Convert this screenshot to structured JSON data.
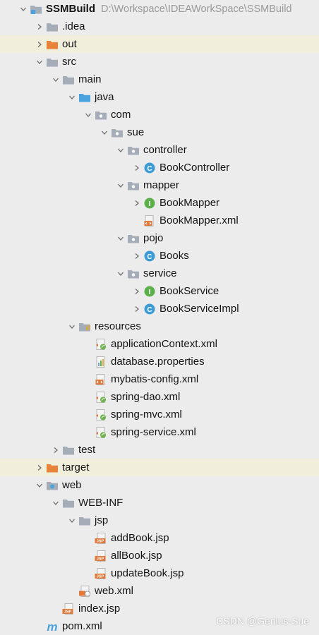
{
  "colors": {
    "folder": "#a5adb8",
    "folder_blue": "#4aa3df",
    "folder_orange": "#e8833a",
    "class_badge": "#3c9bd4",
    "interface_badge": "#5bb04a",
    "xml": "#e0783a",
    "spring_leaf": "#6bb24a",
    "jsp": "#e0783a",
    "highlight": "#f1efdc"
  },
  "tree": [
    {
      "label": "SSMBuild",
      "path": "D:\\Workspace\\IDEAWorkSpace\\SSMBuild",
      "icon": "module-folder-icon",
      "expanded": true,
      "depth": 0
    },
    {
      "label": ".idea",
      "icon": "folder-icon",
      "expanded": false,
      "depth": 1
    },
    {
      "label": "out",
      "icon": "excluded-folder-icon",
      "expanded": false,
      "depth": 1,
      "highlight": true
    },
    {
      "label": "src",
      "icon": "folder-icon",
      "expanded": true,
      "depth": 1
    },
    {
      "label": "main",
      "icon": "folder-icon",
      "expanded": true,
      "depth": 2
    },
    {
      "label": "java",
      "icon": "source-folder-icon",
      "expanded": true,
      "depth": 3
    },
    {
      "label": "com",
      "icon": "package-icon",
      "expanded": true,
      "depth": 4
    },
    {
      "label": "sue",
      "icon": "package-icon",
      "expanded": true,
      "depth": 5
    },
    {
      "label": "controller",
      "icon": "package-icon",
      "expanded": true,
      "depth": 6
    },
    {
      "label": "BookController",
      "icon": "class-icon",
      "expanded": false,
      "depth": 7
    },
    {
      "label": "mapper",
      "icon": "package-icon",
      "expanded": true,
      "depth": 6
    },
    {
      "label": "BookMapper",
      "icon": "interface-icon",
      "expanded": false,
      "depth": 7
    },
    {
      "label": "BookMapper.xml",
      "icon": "xml-file-icon",
      "depth": 7
    },
    {
      "label": "pojo",
      "icon": "package-icon",
      "expanded": true,
      "depth": 6
    },
    {
      "label": "Books",
      "icon": "class-icon",
      "expanded": false,
      "depth": 7
    },
    {
      "label": "service",
      "icon": "package-icon",
      "expanded": true,
      "depth": 6
    },
    {
      "label": "BookService",
      "icon": "interface-icon",
      "expanded": false,
      "depth": 7
    },
    {
      "label": "BookServiceImpl",
      "icon": "class-icon",
      "expanded": false,
      "depth": 7
    },
    {
      "label": "resources",
      "icon": "resources-folder-icon",
      "expanded": true,
      "depth": 3
    },
    {
      "label": "applicationContext.xml",
      "icon": "spring-xml-icon",
      "depth": 4
    },
    {
      "label": "database.properties",
      "icon": "properties-file-icon",
      "depth": 4
    },
    {
      "label": "mybatis-config.xml",
      "icon": "xml-file-icon",
      "depth": 4
    },
    {
      "label": "spring-dao.xml",
      "icon": "spring-xml-icon",
      "depth": 4
    },
    {
      "label": "spring-mvc.xml",
      "icon": "spring-xml-icon",
      "depth": 4
    },
    {
      "label": "spring-service.xml",
      "icon": "spring-xml-icon",
      "depth": 4
    },
    {
      "label": "test",
      "icon": "folder-icon",
      "expanded": false,
      "depth": 2
    },
    {
      "label": "target",
      "icon": "excluded-folder-icon",
      "expanded": false,
      "depth": 1,
      "highlight": true
    },
    {
      "label": "web",
      "icon": "web-folder-icon",
      "expanded": true,
      "depth": 1
    },
    {
      "label": "WEB-INF",
      "icon": "folder-icon",
      "expanded": true,
      "depth": 2
    },
    {
      "label": "jsp",
      "icon": "folder-icon",
      "expanded": true,
      "depth": 3
    },
    {
      "label": "addBook.jsp",
      "icon": "jsp-file-icon",
      "depth": 4
    },
    {
      "label": "allBook.jsp",
      "icon": "jsp-file-icon",
      "depth": 4
    },
    {
      "label": "updateBook.jsp",
      "icon": "jsp-file-icon",
      "depth": 4
    },
    {
      "label": "web.xml",
      "icon": "web-xml-icon",
      "depth": 3
    },
    {
      "label": "index.jsp",
      "icon": "jsp-file-icon",
      "depth": 2
    },
    {
      "label": "pom.xml",
      "icon": "maven-icon",
      "depth": 1
    }
  ],
  "watermark": "CSDN @Genius-Sue"
}
